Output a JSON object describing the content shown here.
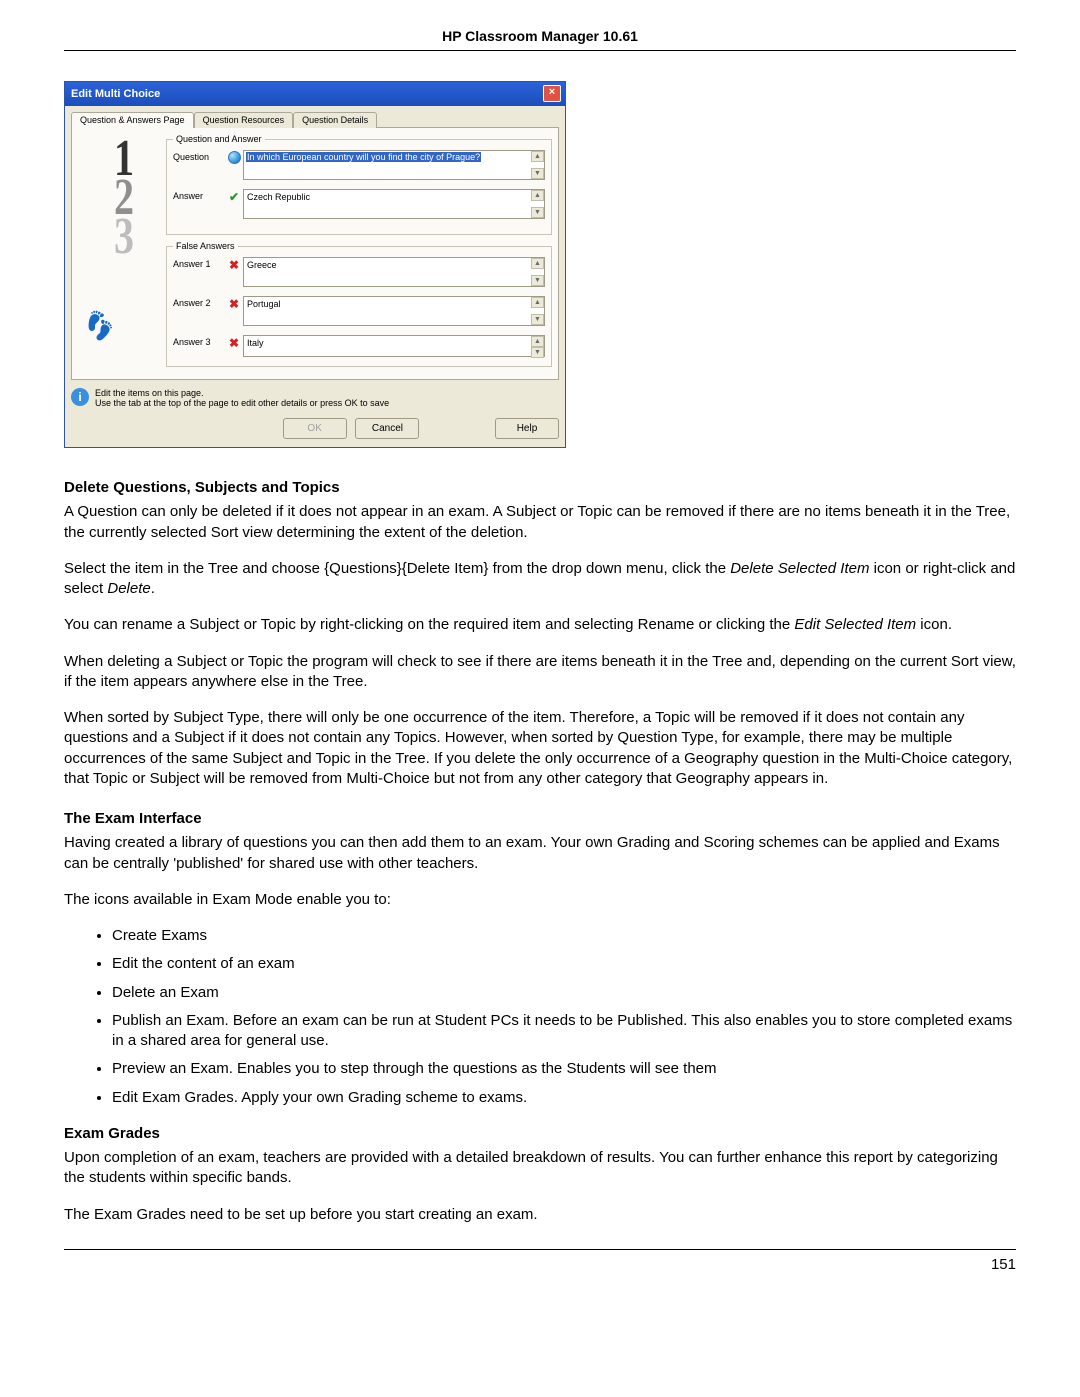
{
  "header": {
    "title": "HP Classroom Manager 10.61"
  },
  "dialog": {
    "title": "Edit Multi Choice",
    "close_label": "×",
    "tabs": {
      "t1": "Question & Answers Page",
      "t2": "Question Resources",
      "t3": "Question Details"
    },
    "qa_legend": "Question and Answer",
    "question_label": "Question",
    "question_value": "In which European country will you find the city of Prague?",
    "answer_label": "Answer",
    "answer_value": "Czech Republic",
    "fa_legend": "False Answers",
    "answer1_label": "Answer 1",
    "answer1_value": "Greece",
    "answer2_label": "Answer 2",
    "answer2_value": "Portugal",
    "answer3_label": "Answer 3",
    "answer3_value": "Italy",
    "hint1": "Edit the items on this page.",
    "hint2": "Use the tab at the top of the page to edit other details or press OK to save",
    "btn_ok": "OK",
    "btn_cancel": "Cancel",
    "btn_help": "Help"
  },
  "doc": {
    "s1_title": "Delete Questions, Subjects and Topics",
    "p1": "A Question can only be deleted if it does not appear in an exam. A Subject or Topic can be removed if there are no items beneath it in the Tree, the currently selected Sort view determining the extent of the deletion.",
    "p2a": "Select the item in the Tree and choose {Questions}{Delete Item} from the drop down menu, click the ",
    "p2b": "Delete Selected Item",
    "p2c": " icon or right-click and select ",
    "p2d": "Delete",
    "p2e": ".",
    "p3a": "You can rename a Subject or Topic by right-clicking on the required item and selecting Rename or clicking the ",
    "p3b": "Edit Selected Item",
    "p3c": " icon.",
    "p4": "When deleting a Subject or Topic the program will check to see if there are items beneath it in the Tree and, depending on the current Sort view, if the item appears anywhere else in the Tree.",
    "p5": "When sorted by Subject Type, there will only be one occurrence of the item. Therefore, a Topic will be removed if it does not contain any questions and a Subject if it does not contain any Topics. However, when sorted by Question Type, for example, there may be multiple occurrences of the same Subject and Topic in the Tree. If you delete the only occurrence of a Geography question in the Multi-Choice category, that Topic or Subject will be removed from Multi-Choice but not from any other category that Geography appears in.",
    "s2_title": "The Exam Interface",
    "p6": "Having created a library of questions you can then add them to an exam. Your own Grading and Scoring schemes can be applied and Exams can be centrally 'published' for shared use with other teachers.",
    "p7": "The icons available in Exam Mode enable you to:",
    "li1": "Create Exams",
    "li2": "Edit the content of an exam",
    "li3": "Delete an Exam",
    "li4": "Publish an Exam. Before an exam can be run at Student PCs it needs to be Published. This also enables you to store completed exams in a shared area for general use.",
    "li5": "Preview an Exam. Enables you to step through the questions as the Students will see them",
    "li6": "Edit Exam Grades. Apply your own Grading scheme to exams.",
    "s3_title": "Exam Grades",
    "p8": "Upon completion of an exam, teachers are provided with a detailed breakdown of results. You can further enhance this report by categorizing the students within specific bands.",
    "p9": "The Exam Grades need to be set up before you start creating an exam."
  },
  "page_number": "151"
}
